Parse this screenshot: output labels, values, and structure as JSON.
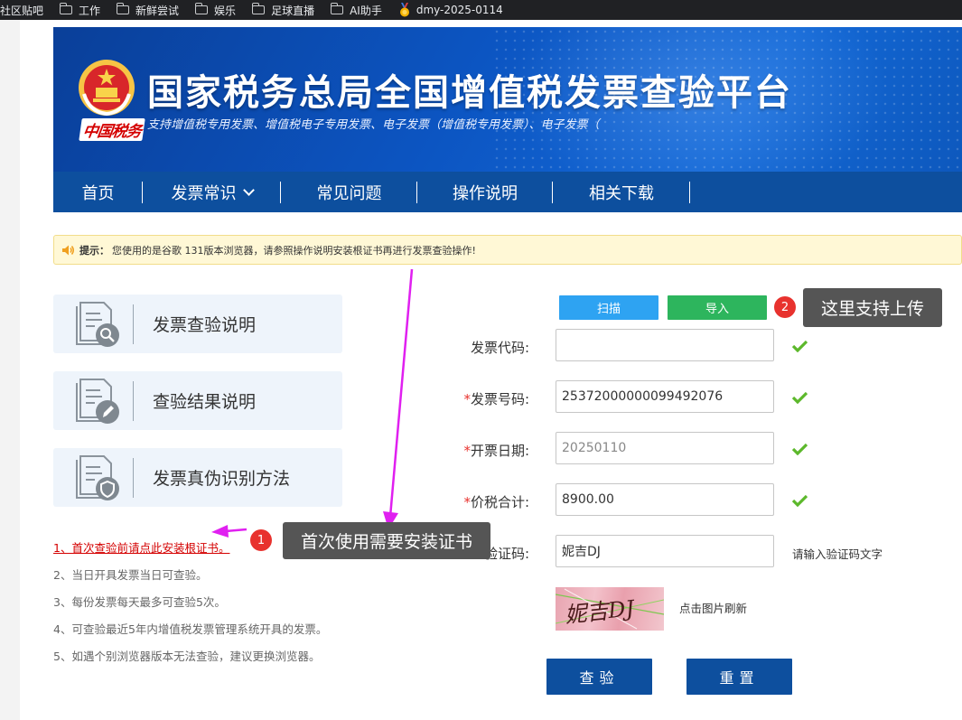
{
  "bookmarks": [
    {
      "label": "社区贴吧",
      "icon": "none"
    },
    {
      "label": "工作",
      "icon": "folder-icon"
    },
    {
      "label": "新鲜尝试",
      "icon": "folder-icon"
    },
    {
      "label": "娱乐",
      "icon": "folder-icon"
    },
    {
      "label": "足球直播",
      "icon": "folder-icon"
    },
    {
      "label": "AI助手",
      "icon": "folder-icon"
    },
    {
      "label": "dmy-2025-0114",
      "icon": "medal-icon"
    }
  ],
  "header": {
    "logo_text": "中国税务",
    "title": "国家税务总局全国增值税发票查验平台",
    "subtitle": "支持增值税专用发票、增值税电子专用发票、电子发票（增值税专用发票）、电子发票（"
  },
  "nav": {
    "items": [
      "首页",
      "发票常识",
      "常见问题",
      "操作说明",
      "相关下载"
    ]
  },
  "tip": {
    "label": "提示：",
    "text": "您使用的是谷歌 131版本浏览器，请参照操作说明安装根证书再进行发票查验操作!"
  },
  "cards": [
    {
      "label": "发票查验说明",
      "icon": "search-document-icon"
    },
    {
      "label": "查验结果说明",
      "icon": "edit-document-icon"
    },
    {
      "label": "发票真伪识别方法",
      "icon": "shield-document-icon"
    }
  ],
  "notes": [
    "1、首次查验前请点此安装根证书。",
    "2、当日开具发票当日可查验。",
    "3、每份发票每天最多可查验5次。",
    "4、可查验最近5年内增值税发票管理系统开具的发票。",
    "5、如遇个别浏览器版本无法查验，建议更换浏览器。"
  ],
  "form": {
    "scan_label": "扫描",
    "import_label": "导入",
    "invoice_code_label": "发票代码:",
    "invoice_code_value": "",
    "invoice_number_label": "发票号码:",
    "invoice_number_value": "25372000000099492076",
    "issue_date_label": "开票日期:",
    "issue_date_value": "20250110",
    "total_label": "价税合计:",
    "total_value": "8900.00",
    "captcha_label": "验证码:",
    "captcha_value": "妮吉DJ",
    "captcha_hint": "请输入验证码文字",
    "captcha_image_text": "妮吉DJ",
    "refresh_hint": "点击图片刷新",
    "submit_label": "查验",
    "reset_label": "重置"
  },
  "annotations": {
    "badge1": "1",
    "tooltip1": "首次使用需要安装证书",
    "badge2": "2",
    "tooltip2": "这里支持上传"
  },
  "colors": {
    "nav_bg": "#0d4f9e",
    "scan_button": "#2ea3f2",
    "import_button": "#2db55d",
    "badge": "#e8322e",
    "arrow": "#e020f0"
  }
}
